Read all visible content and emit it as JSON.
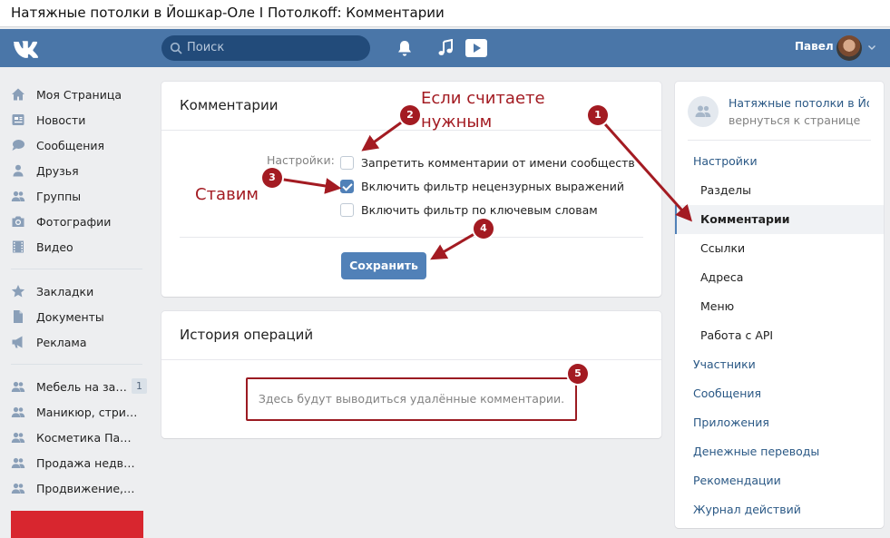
{
  "window_title": "Натяжные потолки в Йошкар-Оле I Потолкoff: Комментарии",
  "topbar": {
    "search_placeholder": "Поиск",
    "user_name": "Павел"
  },
  "left_nav": {
    "main": [
      {
        "label": "Моя Страница",
        "icon": "home-icon"
      },
      {
        "label": "Новости",
        "icon": "news-icon"
      },
      {
        "label": "Сообщения",
        "icon": "messages-icon"
      },
      {
        "label": "Друзья",
        "icon": "friends-icon"
      },
      {
        "label": "Группы",
        "icon": "groups-icon"
      },
      {
        "label": "Фотографии",
        "icon": "camera-icon"
      },
      {
        "label": "Видео",
        "icon": "video-icon"
      }
    ],
    "secondary": [
      {
        "label": "Закладки",
        "icon": "star-icon"
      },
      {
        "label": "Документы",
        "icon": "document-icon"
      },
      {
        "label": "Реклама",
        "icon": "megaphone-icon"
      }
    ],
    "communities": [
      {
        "label": "Мебель на заказ",
        "count": "1"
      },
      {
        "label": "Маникюр, стрижка"
      },
      {
        "label": "Косметика Парфюмерия"
      },
      {
        "label": "Продажа недвижимости"
      },
      {
        "label": "Продвижение, Ре..."
      }
    ]
  },
  "comments_card": {
    "title": "Комментарии",
    "settings_label": "Настройки:",
    "options": [
      {
        "label": "Запретить комментарии от имени сообществ",
        "checked": false
      },
      {
        "label": "Включить фильтр нецензурных выражений",
        "checked": true
      },
      {
        "label": "Включить фильтр по ключевым словам",
        "checked": false
      }
    ],
    "save_label": "Сохранить"
  },
  "history_card": {
    "title": "История операций",
    "empty_text": "Здесь будут выводиться удалённые комментарии."
  },
  "right_panel": {
    "group_name": "Натяжные потолки в Йошкар-Оле",
    "back_link": "вернуться к странице",
    "menu": [
      {
        "label": "Настройки",
        "level": "top"
      },
      {
        "label": "Разделы",
        "level": "sub"
      },
      {
        "label": "Комментарии",
        "level": "sub",
        "active": true
      },
      {
        "label": "Ссылки",
        "level": "sub"
      },
      {
        "label": "Адреса",
        "level": "sub"
      },
      {
        "label": "Меню",
        "level": "sub"
      },
      {
        "label": "Работа с API",
        "level": "sub"
      },
      {
        "label": "Участники",
        "level": "top"
      },
      {
        "label": "Сообщения",
        "level": "top"
      },
      {
        "label": "Приложения",
        "level": "top"
      },
      {
        "label": "Денежные переводы",
        "level": "top"
      },
      {
        "label": "Рекомендации",
        "level": "top"
      },
      {
        "label": "Журнал действий",
        "level": "top"
      }
    ]
  },
  "annotations": {
    "text_if_needed": "Если считаете\nнужным",
    "text_set": "Ставим",
    "badges": [
      "1",
      "2",
      "3",
      "4",
      "5"
    ],
    "color": "#a31b22"
  },
  "colors": {
    "header": "#4a76a8",
    "accent": "#5181b8",
    "link": "#2a5885",
    "background": "#edeef0"
  }
}
